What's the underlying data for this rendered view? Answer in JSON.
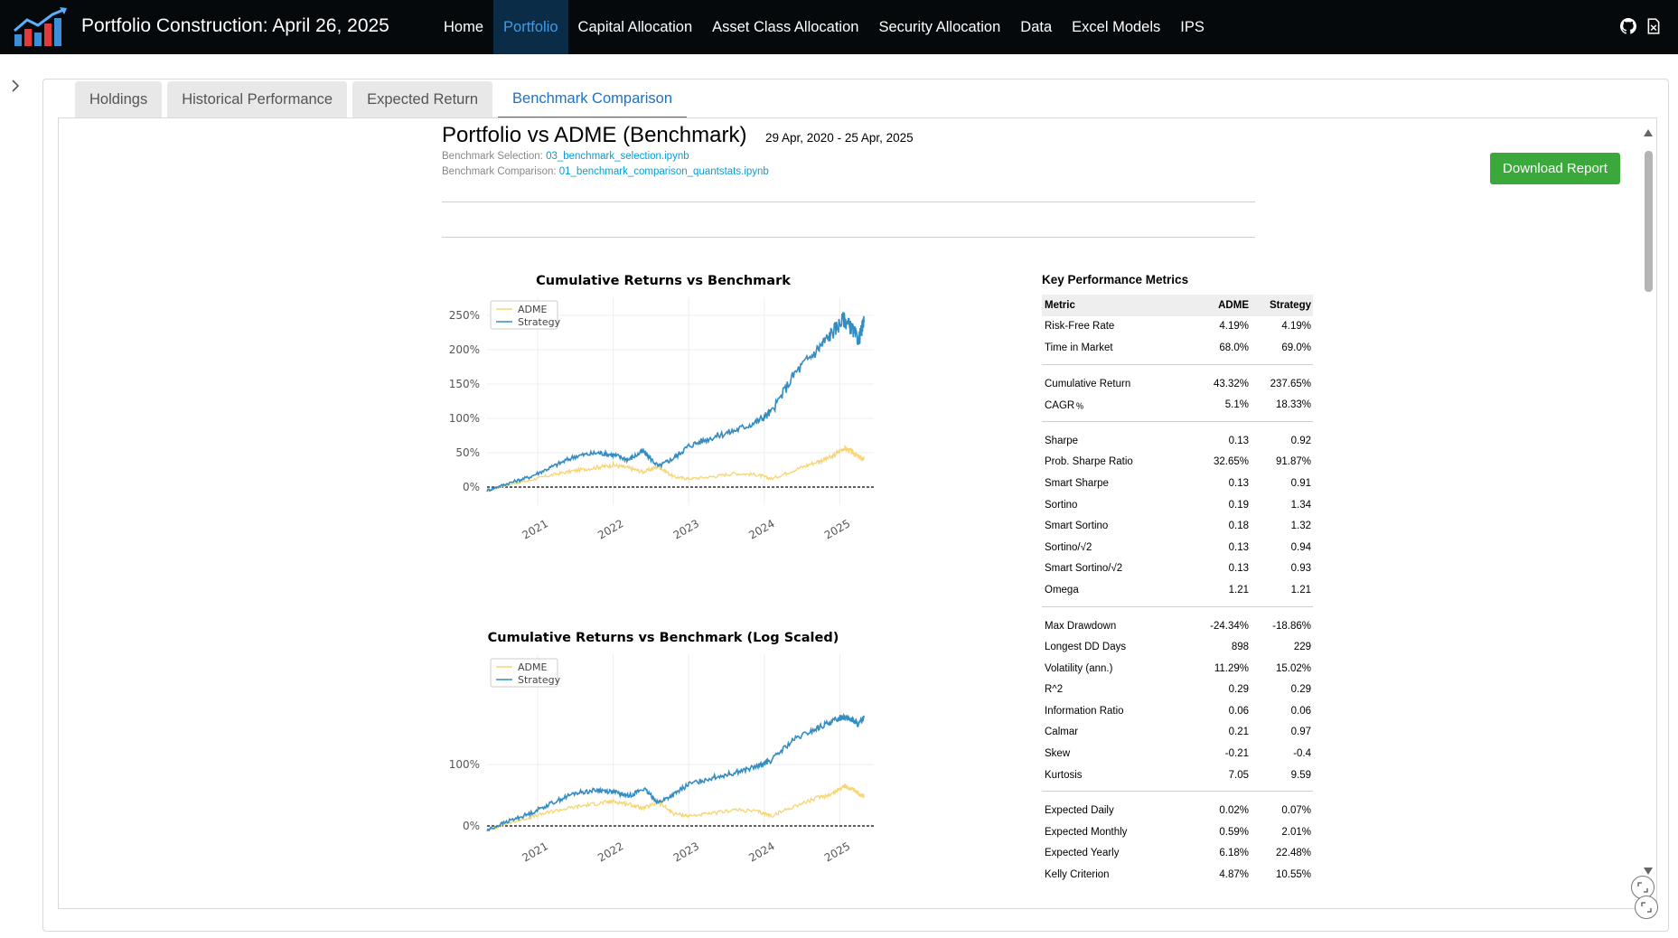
{
  "navbar": {
    "title": "Portfolio Construction: April 26, 2025",
    "items": [
      {
        "label": "Home",
        "active": false
      },
      {
        "label": "Portfolio",
        "active": true
      },
      {
        "label": "Capital Allocation",
        "active": false
      },
      {
        "label": "Asset Class Allocation",
        "active": false
      },
      {
        "label": "Security Allocation",
        "active": false
      },
      {
        "label": "Data",
        "active": false
      },
      {
        "label": "Excel Models",
        "active": false
      },
      {
        "label": "IPS",
        "active": false
      }
    ],
    "icons": [
      "github-icon",
      "excel-icon"
    ]
  },
  "tabs": [
    {
      "label": "Holdings",
      "active": false
    },
    {
      "label": "Historical Performance",
      "active": false
    },
    {
      "label": "Expected Return",
      "active": false
    },
    {
      "label": "Benchmark Comparison",
      "active": true
    }
  ],
  "report": {
    "title": "Portfolio vs ADME (Benchmark)",
    "dates": "29 Apr, 2020 - 25 Apr, 2025",
    "selection_prefix": "Benchmark Selection: ",
    "selection_link": "03_benchmark_selection.ipynb",
    "comparison_prefix": "Benchmark Comparison: ",
    "comparison_link": "01_benchmark_comparison_quantstats.ipynb",
    "download_label": "Download Report"
  },
  "colors": {
    "benchmark": "#f7d572",
    "strategy": "#348dc1",
    "nav_active": "#3d9be6",
    "button": "#3aa83a"
  },
  "chart_data": [
    {
      "type": "line",
      "title": "Cumulative Returns vs Benchmark",
      "legend": [
        "ADME",
        "Strategy"
      ],
      "legend_position": "top-left",
      "x_ticks": [
        "2021",
        "2022",
        "2023",
        "2024",
        "2025"
      ],
      "y_ticks": [
        "0%",
        "50%",
        "100%",
        "150%",
        "200%",
        "250%"
      ],
      "ylim": [
        -10,
        265
      ],
      "grid": true,
      "baseline": "0% dashed",
      "series": [
        {
          "name": "ADME",
          "x": [
            2020.33,
            2020.6,
            2020.9,
            2021.2,
            2021.5,
            2021.8,
            2022.0,
            2022.2,
            2022.4,
            2022.6,
            2022.8,
            2023.0,
            2023.3,
            2023.6,
            2023.9,
            2024.1,
            2024.4,
            2024.7,
            2024.9,
            2025.05,
            2025.15,
            2025.25,
            2025.32
          ],
          "values": [
            -5,
            3,
            10,
            18,
            24,
            29,
            32,
            28,
            22,
            30,
            15,
            12,
            15,
            20,
            18,
            12,
            25,
            37,
            44,
            57,
            52,
            44,
            40
          ]
        },
        {
          "name": "Strategy",
          "x": [
            2020.33,
            2020.6,
            2020.9,
            2021.2,
            2021.5,
            2021.8,
            2022.0,
            2022.2,
            2022.4,
            2022.6,
            2022.8,
            2023.0,
            2023.3,
            2023.6,
            2023.9,
            2024.1,
            2024.4,
            2024.7,
            2024.9,
            2025.05,
            2025.15,
            2025.25,
            2025.32
          ],
          "values": [
            -5,
            5,
            15,
            30,
            45,
            50,
            47,
            40,
            52,
            30,
            42,
            60,
            72,
            82,
            95,
            110,
            165,
            200,
            225,
            245,
            232,
            214,
            240
          ]
        }
      ]
    },
    {
      "type": "line",
      "title": "Cumulative Returns vs Benchmark (Log Scaled)",
      "legend": [
        "ADME",
        "Strategy"
      ],
      "legend_position": "top-left",
      "x_ticks": [
        "2021",
        "2022",
        "2023",
        "2024",
        "2025"
      ],
      "y_ticks": [
        "0%",
        "100%"
      ],
      "log_scale": true,
      "grid": true,
      "baseline": "0% dashed",
      "series": [
        {
          "name": "ADME",
          "x": [
            2020.33,
            2020.6,
            2020.9,
            2021.2,
            2021.5,
            2021.8,
            2022.0,
            2022.2,
            2022.4,
            2022.6,
            2022.8,
            2023.0,
            2023.3,
            2023.6,
            2023.9,
            2024.1,
            2024.4,
            2024.7,
            2024.9,
            2025.05,
            2025.15,
            2025.25,
            2025.32
          ],
          "values": [
            -5,
            3,
            10,
            18,
            24,
            29,
            32,
            28,
            22,
            30,
            15,
            12,
            15,
            20,
            18,
            12,
            25,
            37,
            44,
            57,
            52,
            44,
            40
          ]
        },
        {
          "name": "Strategy",
          "x": [
            2020.33,
            2020.6,
            2020.9,
            2021.2,
            2021.5,
            2021.8,
            2022.0,
            2022.2,
            2022.4,
            2022.6,
            2022.8,
            2023.0,
            2023.3,
            2023.6,
            2023.9,
            2024.1,
            2024.4,
            2024.7,
            2024.9,
            2025.05,
            2025.15,
            2025.25,
            2025.32
          ],
          "values": [
            -5,
            5,
            15,
            30,
            45,
            50,
            47,
            40,
            52,
            30,
            42,
            60,
            72,
            82,
            95,
            110,
            165,
            200,
            225,
            245,
            232,
            214,
            240
          ]
        }
      ]
    }
  ],
  "metrics": {
    "title": "Key Performance Metrics",
    "header": [
      "Metric",
      "ADME",
      "Strategy"
    ],
    "groups": [
      [
        [
          "Risk-Free Rate",
          "4.19%",
          "4.19%"
        ],
        [
          "Time in Market",
          "68.0%",
          "69.0%"
        ]
      ],
      [
        [
          "Cumulative Return",
          "43.32%",
          "237.65%"
        ],
        [
          "CAGR﹪",
          "5.1%",
          "18.33%"
        ]
      ],
      [
        [
          "Sharpe",
          "0.13",
          "0.92"
        ],
        [
          "Prob. Sharpe Ratio",
          "32.65%",
          "91.87%"
        ],
        [
          "Smart Sharpe",
          "0.13",
          "0.91"
        ],
        [
          "Sortino",
          "0.19",
          "1.34"
        ],
        [
          "Smart Sortino",
          "0.18",
          "1.32"
        ],
        [
          "Sortino/√2",
          "0.13",
          "0.94"
        ],
        [
          "Smart Sortino/√2",
          "0.13",
          "0.93"
        ],
        [
          "Omega",
          "1.21",
          "1.21"
        ]
      ],
      [
        [
          "Max Drawdown",
          "-24.34%",
          "-18.86%"
        ],
        [
          "Longest DD Days",
          "898",
          "229"
        ],
        [
          "Volatility (ann.)",
          "11.29%",
          "15.02%"
        ],
        [
          "R^2",
          "0.29",
          "0.29"
        ],
        [
          "Information Ratio",
          "0.06",
          "0.06"
        ],
        [
          "Calmar",
          "0.21",
          "0.97"
        ],
        [
          "Skew",
          "-0.21",
          "-0.4"
        ],
        [
          "Kurtosis",
          "7.05",
          "9.59"
        ]
      ],
      [
        [
          "Expected Daily",
          "0.02%",
          "0.07%"
        ],
        [
          "Expected Monthly",
          "0.59%",
          "2.01%"
        ],
        [
          "Expected Yearly",
          "6.18%",
          "22.48%"
        ],
        [
          "Kelly Criterion",
          "4.87%",
          "10.55%"
        ]
      ]
    ]
  }
}
